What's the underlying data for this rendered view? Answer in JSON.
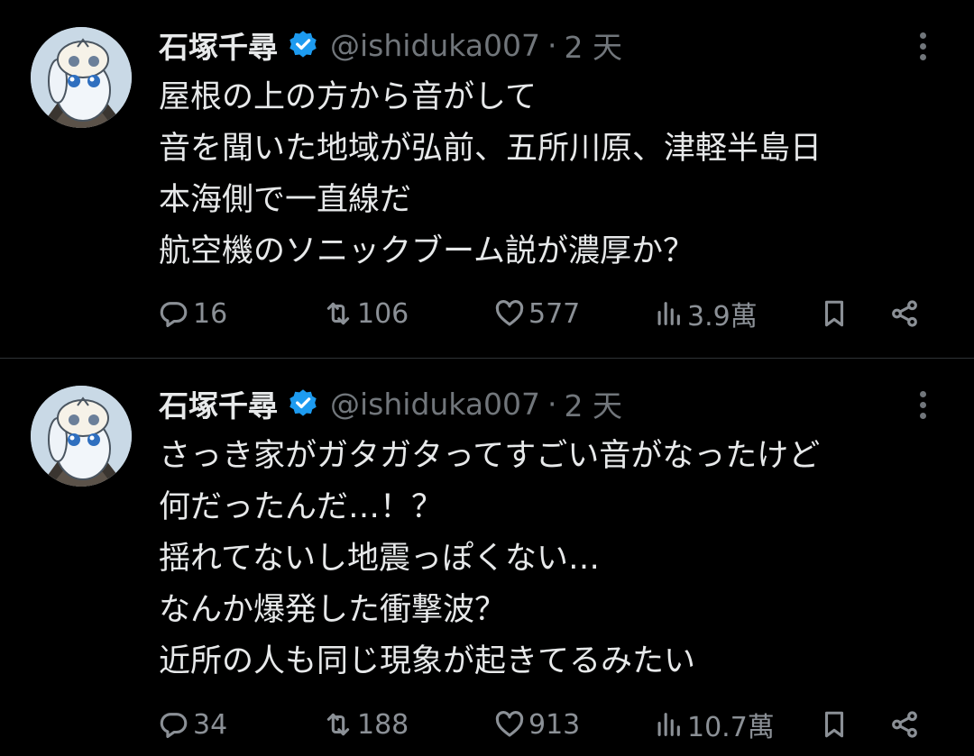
{
  "tweets": [
    {
      "author": {
        "name": "石塚千尋",
        "handle": "@ishiduka007"
      },
      "dot": "·",
      "time": "2 天",
      "lines": [
        "屋根の上の方から音がして",
        "音を聞いた地域が弘前、五所川原、津軽半島日",
        "本海側で一直線だ",
        "航空機のソニックブーム説が濃厚か？"
      ],
      "stats": {
        "replies": "16",
        "reposts": "106",
        "likes": "577",
        "views": "3.9萬"
      }
    },
    {
      "author": {
        "name": "石塚千尋",
        "handle": "@ishiduka007"
      },
      "dot": "·",
      "time": "2 天",
      "lines": [
        "さっき家がガタガタってすごい音がなったけど",
        "何だったんだ…！？",
        "揺れてないし地震っぽくない…",
        "なんか爆発した衝撃波？",
        "近所の人も同じ現象が起きてるみたい"
      ],
      "stats": {
        "replies": "34",
        "reposts": "188",
        "likes": "913",
        "views": "10.7萬"
      }
    }
  ],
  "icons": {
    "verified": "verified-badge-icon",
    "more": "more-options-icon",
    "reply": "reply-icon",
    "repost": "repost-icon",
    "like": "heart-icon",
    "views": "views-chart-icon",
    "bookmark": "bookmark-icon",
    "share": "share-icon"
  },
  "colors": {
    "background": "#000000",
    "text": "#e7e9ea",
    "secondary": "#71767b",
    "verified": "#1d9bf0",
    "divider": "#2f3336"
  }
}
